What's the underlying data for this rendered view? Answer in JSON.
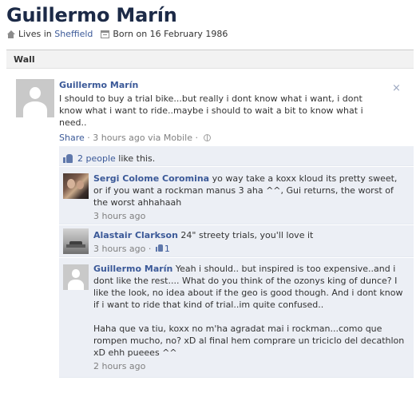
{
  "profile": {
    "name": "Guillermo Marín",
    "lives_prefix": "Lives in",
    "city": "Sheffield",
    "born": "Born on 16 February 1986"
  },
  "tabs": {
    "active": "Wall"
  },
  "post": {
    "author": "Guillermo Marín",
    "text": "I should to buy a trial bike...but really i dont know what i want, i dont know what i want to ride..maybe i should to wait a bit to know what i need..",
    "share_label": "Share",
    "separator": " · ",
    "time": "3 hours ago via Mobile",
    "close_glyph": "×"
  },
  "likes": {
    "count_label": "2 people",
    "suffix": " like this."
  },
  "comments": [
    {
      "author": "Sergi Colome Coromina",
      "text": "yo way take a koxx kloud its pretty sweet, or if you want a rockman manus 3 aha ^^, Gui returns, the worst of the worst ahhahaah",
      "time": "3 hours ago"
    },
    {
      "author": "Alastair Clarkson",
      "text": "24\" streety trials, you'll love it",
      "time": "3 hours ago",
      "separator": " · ",
      "like_count": "1"
    },
    {
      "author": "Guillermo Marín",
      "text": "Yeah i should.. but inspired is too expensive..and i dont like the rest.... What do you think of the ozonys king of dunce? I like the look, no idea about if the geo is good though. And i dont know if i want to ride that kind of trial..im quite confused..",
      "text2": "Haha que va tiu, koxx no m'ha agradat mai i rockman...como que rompen mucho, no? xD al final hem comprare un triciclo del decathlon xD ehh pueees ^^",
      "time": "2 hours ago"
    }
  ],
  "icons": {
    "house": "house-icon",
    "calendar": "calendar-icon",
    "globe": "globe-icon",
    "thumb": "thumbs-up-icon",
    "close": "close-icon"
  },
  "colors": {
    "link": "#3b5998",
    "feedback_bg": "#eceff5",
    "tab_bg": "#f2f2f2",
    "name": "#1c2a47"
  }
}
